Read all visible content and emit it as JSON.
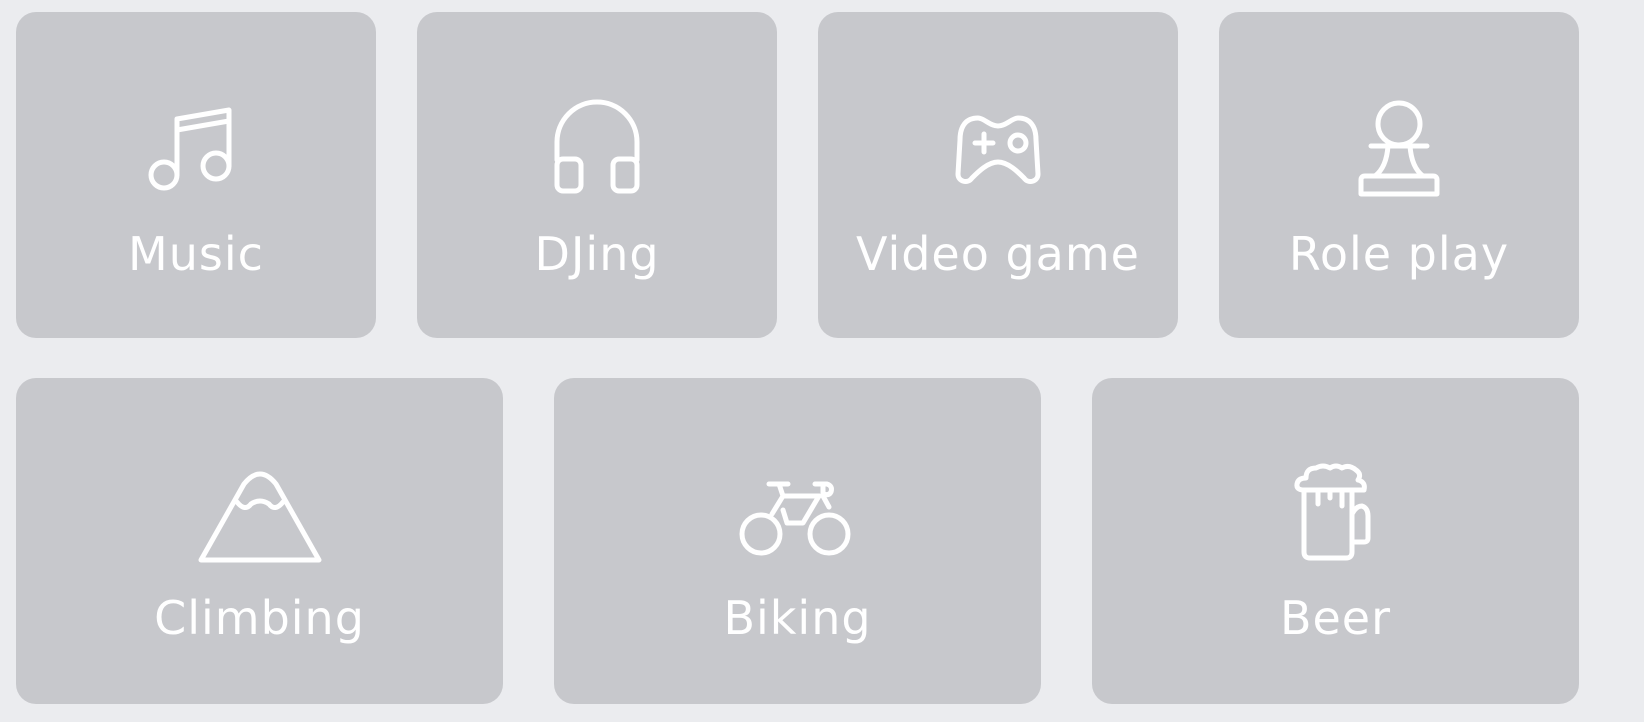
{
  "categories": [
    {
      "id": "music",
      "label": "Music",
      "icon": "music-note-icon"
    },
    {
      "id": "djing",
      "label": "DJing",
      "icon": "headphones-icon"
    },
    {
      "id": "video-game",
      "label": "Video game",
      "icon": "gamepad-icon"
    },
    {
      "id": "role-play",
      "label": "Role play",
      "icon": "chess-pawn-icon"
    },
    {
      "id": "climbing",
      "label": "Climbing",
      "icon": "mountain-icon"
    },
    {
      "id": "biking",
      "label": "Biking",
      "icon": "bicycle-icon"
    },
    {
      "id": "beer",
      "label": "Beer",
      "icon": "beer-mug-icon"
    }
  ],
  "colors": {
    "background": "#ebecef",
    "card": "#c7c8cc",
    "foreground": "#ffffff"
  }
}
